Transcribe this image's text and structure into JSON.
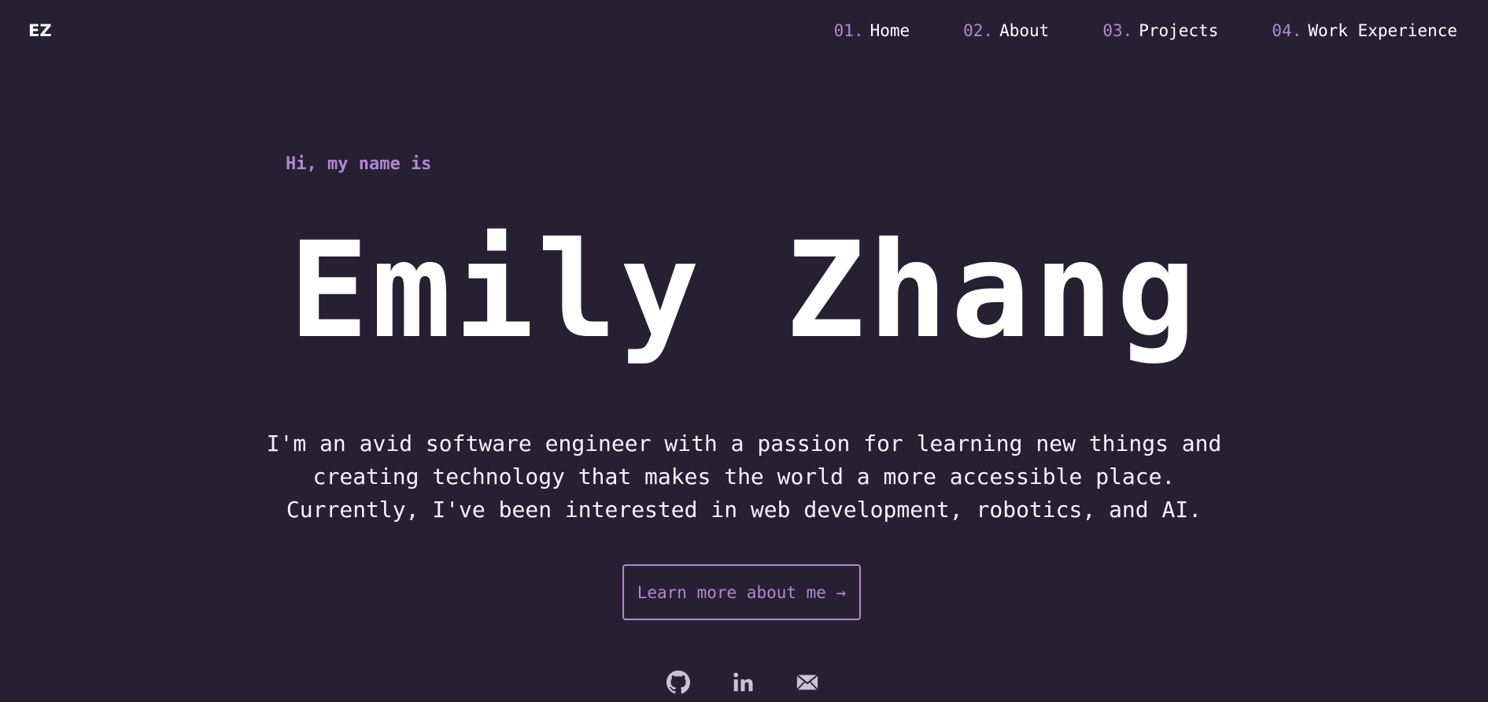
{
  "header": {
    "logo": "EZ",
    "nav": [
      {
        "num": "01.",
        "label": "Home"
      },
      {
        "num": "02.",
        "label": "About"
      },
      {
        "num": "03.",
        "label": "Projects"
      },
      {
        "num": "04.",
        "label": "Work Experience"
      }
    ]
  },
  "hero": {
    "greeting": "Hi, my name is",
    "name": "Emily Zhang",
    "intro_lines": [
      "I'm an avid software engineer with a passion for learning new things and",
      "creating technology that makes the world a more accessible place.",
      "Currently, I've been interested in web development, robotics, and AI."
    ],
    "cta_label": "Learn more about me →"
  },
  "socials": [
    {
      "icon": "github-icon"
    },
    {
      "icon": "linkedin-icon"
    },
    {
      "icon": "mail-icon"
    }
  ],
  "colors": {
    "background": "#272033",
    "accent": "#b187d4",
    "text": "#ffffff"
  }
}
